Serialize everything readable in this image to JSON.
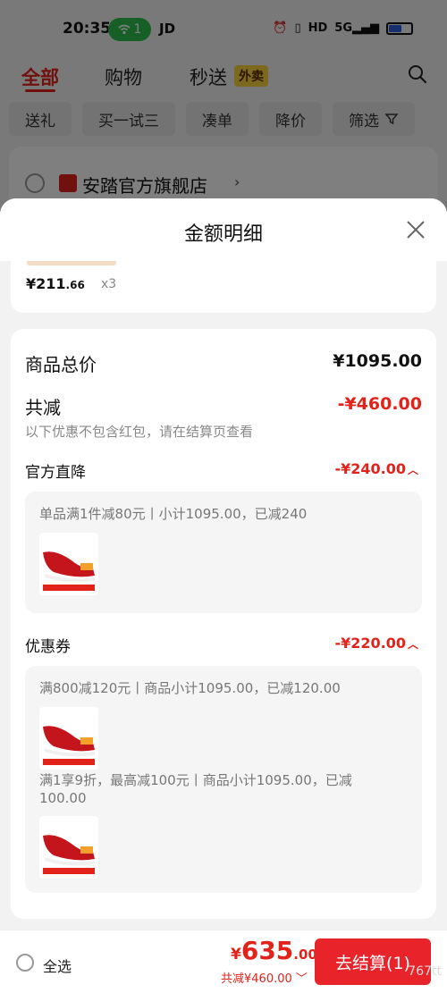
{
  "status_bar": {
    "time": "20:35",
    "wifi_count": "1",
    "carrier": "JD",
    "network_label": "5G"
  },
  "top_nav": {
    "tabs": [
      {
        "label": "全部",
        "active": true
      },
      {
        "label": "购物",
        "active": false
      },
      {
        "label": "秒送",
        "active": false
      }
    ],
    "takeaway_badge": "外卖"
  },
  "filter_chips": [
    "送礼",
    "买一试三",
    "凑单",
    "降价",
    "筛选"
  ],
  "store": {
    "name": "安踏官方旗舰店"
  },
  "sheet": {
    "title": "金额明细",
    "product": {
      "price_symbol": "¥",
      "price_int": "211",
      "price_dec": ".66",
      "quantity": "x3"
    },
    "summary": {
      "total_label": "商品总价",
      "total_value": "¥1095.00",
      "discount_label": "共减",
      "discount_value": "-¥460.00",
      "hint": "以下优惠不包含红包，请在结算页查看"
    },
    "official_drop": {
      "label": "官方直降",
      "value": "-¥240.00",
      "rule": "单品满1件减80元丨小计1095.00，已减240"
    },
    "coupon": {
      "label": "优惠券",
      "value": "-¥220.00",
      "rule1": "满800减120元丨商品小计1095.00，已减120.00",
      "rule2_line1": "满1享9折，最高减100元丨商品小计1095.00，已减",
      "rule2_line2": "100.00"
    }
  },
  "bottom_bar": {
    "select_all": "全选",
    "price_symbol": "¥",
    "price_int": "635",
    "price_dec": ".00",
    "discount_text": "共减¥460.00",
    "checkout_label": "去结算(1)",
    "watermark": "767tt"
  },
  "colors": {
    "accent": "#e2231a",
    "checkout": "#e8232a",
    "badge": "#f9d23b",
    "wifi_pill": "#2dbe4e"
  }
}
